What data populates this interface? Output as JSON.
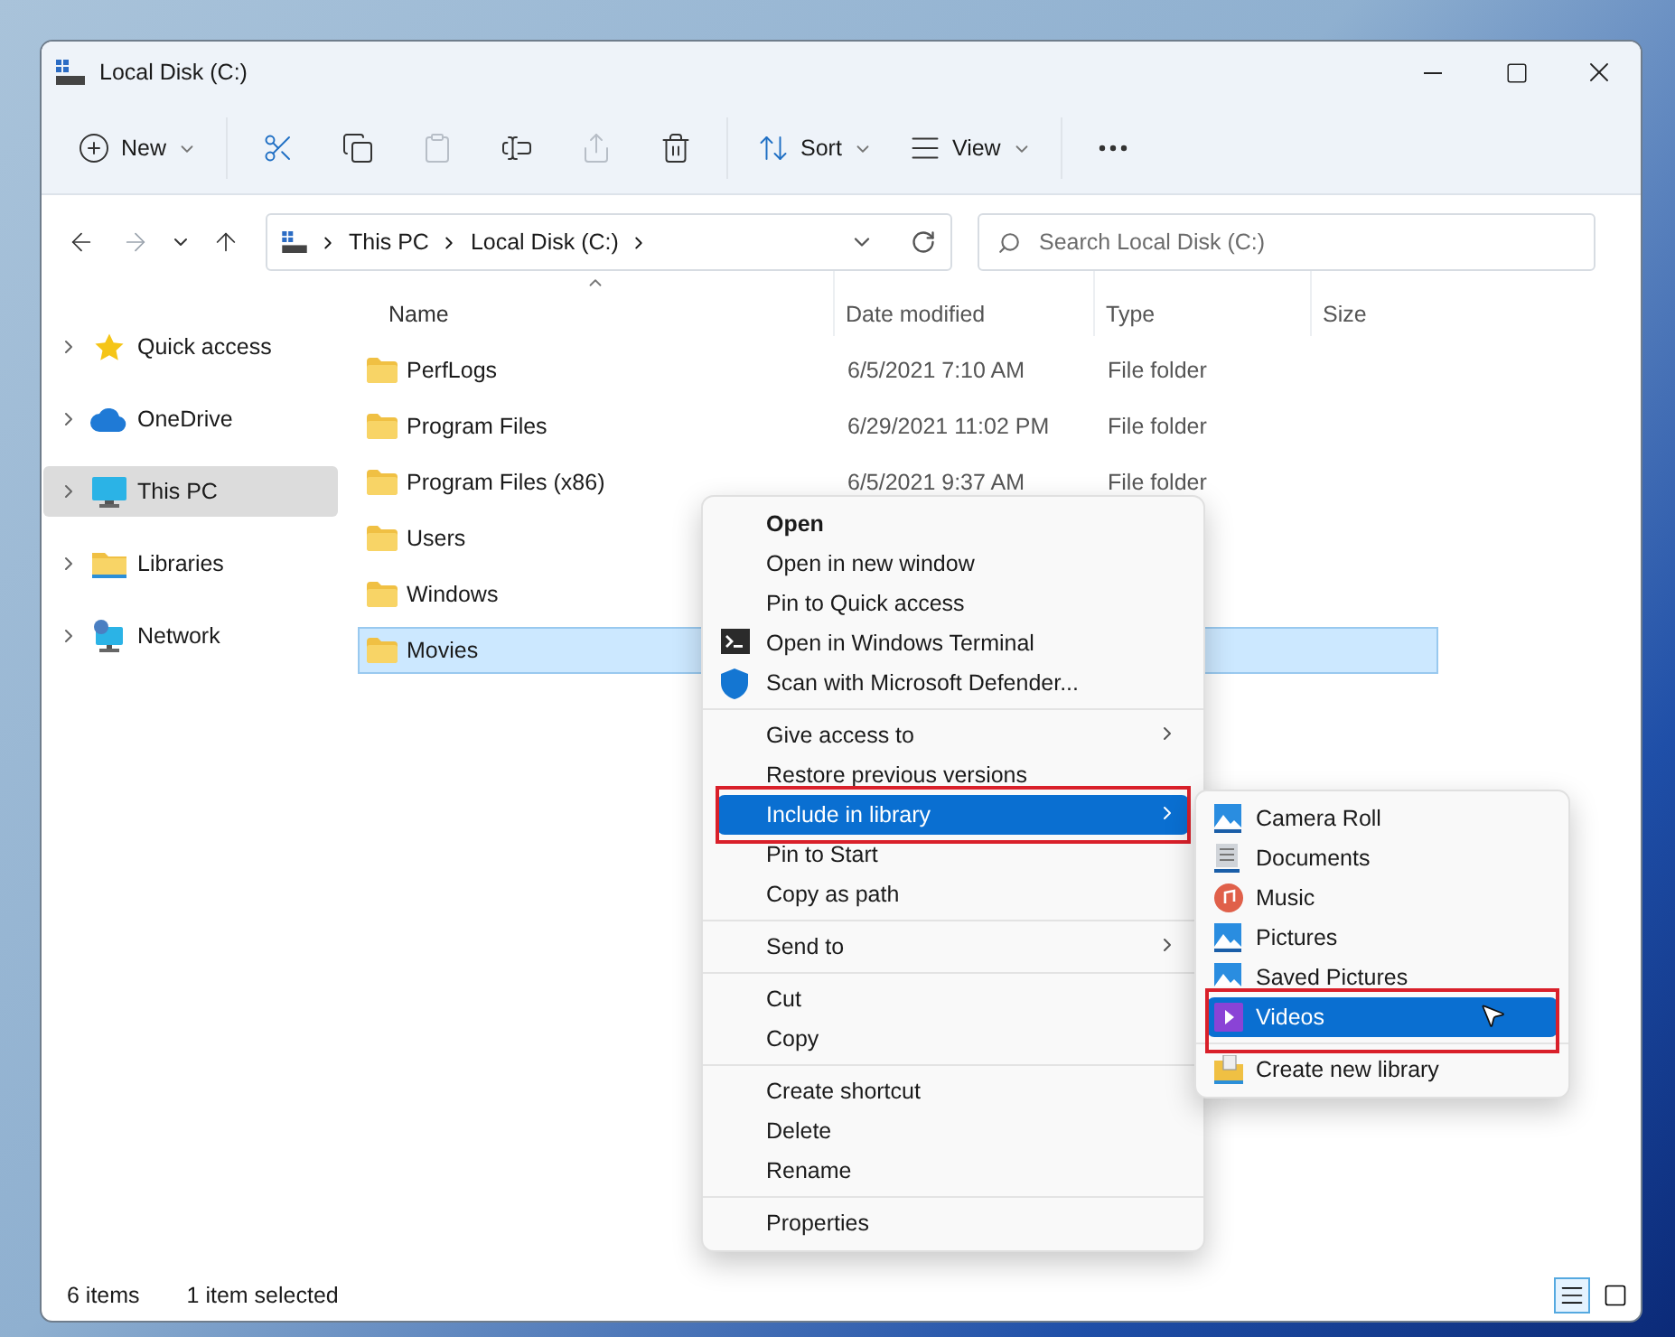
{
  "window": {
    "title": "Local Disk (C:)"
  },
  "toolbar": [
    {
      "label": "New",
      "disabled": false,
      "dropdown": true
    },
    {
      "disabled": false,
      "dropdown": false
    },
    {
      "disabled": false,
      "dropdown": false
    },
    {
      "disabled": true,
      "dropdown": false
    },
    {
      "disabled": false,
      "dropdown": false
    },
    {
      "disabled": true,
      "dropdown": false
    },
    {
      "disabled": false,
      "dropdown": false
    },
    {
      "label": "Sort",
      "disabled": false,
      "dropdown": true
    },
    {
      "label": "View",
      "disabled": false,
      "dropdown": true
    },
    {
      "disabled": false,
      "dropdown": false
    }
  ],
  "address": {
    "path": [
      "This PC",
      "Local Disk (C:)"
    ]
  },
  "search": {
    "placeholder": "Search Local Disk (C:)"
  },
  "sidebar": {
    "items": [
      {
        "label": "Quick access",
        "selected": false,
        "expanded": false
      },
      {
        "label": "OneDrive",
        "selected": false,
        "expanded": false
      },
      {
        "label": "This PC",
        "selected": true,
        "expanded": false
      },
      {
        "label": "Libraries",
        "selected": false,
        "expanded": false
      },
      {
        "label": "Network",
        "selected": false,
        "expanded": false
      }
    ]
  },
  "table": {
    "columns": [
      {
        "label": "Name",
        "sorted": true
      },
      {
        "label": "Date modified",
        "sorted": false
      },
      {
        "label": "Type",
        "sorted": false
      },
      {
        "label": "Size",
        "sorted": false
      }
    ],
    "rows": [
      {
        "name": "PerfLogs",
        "date": "6/5/2021 7:10 AM",
        "type": "File folder",
        "selected": false
      },
      {
        "name": "Program Files",
        "date": "6/29/2021 11:02 PM",
        "type": "File folder",
        "selected": false
      },
      {
        "name": "Program Files (x86)",
        "date": "6/5/2021 9:37 AM",
        "type": "File folder",
        "selected": false
      },
      {
        "name": "Users",
        "selected": false
      },
      {
        "name": "Windows",
        "selected": false
      },
      {
        "name": "Movies",
        "selected": true
      }
    ]
  },
  "status_bar": {
    "count": "6 items",
    "selection": "1 item selected",
    "views": [
      {
        "selected": true
      },
      {
        "selected": false
      }
    ]
  },
  "context_menu": {
    "groups": [
      [
        {
          "label": "Open",
          "bold": true,
          "submenu": false,
          "selected": false,
          "annotated": false
        },
        {
          "label": "Open in new window",
          "bold": false,
          "submenu": false,
          "selected": false,
          "annotated": false
        },
        {
          "label": "Pin to Quick access",
          "bold": false,
          "submenu": false,
          "selected": false,
          "annotated": false
        },
        {
          "label": "Open in Windows Terminal",
          "bold": false,
          "submenu": false,
          "selected": false,
          "annotated": false
        },
        {
          "label": "Scan with Microsoft Defender...",
          "bold": false,
          "submenu": false,
          "selected": false,
          "annotated": false
        }
      ],
      [
        {
          "label": "Give access to",
          "bold": false,
          "submenu": true,
          "selected": false,
          "annotated": false
        },
        {
          "label": "Restore previous versions",
          "bold": false,
          "submenu": false,
          "selected": false,
          "annotated": false
        },
        {
          "label": "Include in library",
          "bold": false,
          "submenu": true,
          "selected": true,
          "annotated": true
        },
        {
          "label": "Pin to Start",
          "bold": false,
          "submenu": false,
          "selected": false,
          "annotated": false
        },
        {
          "label": "Copy as path",
          "bold": false,
          "submenu": false,
          "selected": false,
          "annotated": false
        }
      ],
      [
        {
          "label": "Send to",
          "bold": false,
          "submenu": true,
          "selected": false,
          "annotated": false
        }
      ],
      [
        {
          "label": "Cut",
          "bold": false,
          "submenu": false,
          "selected": false,
          "annotated": false
        },
        {
          "label": "Copy",
          "bold": false,
          "submenu": false,
          "selected": false,
          "annotated": false
        }
      ],
      [
        {
          "label": "Create shortcut",
          "bold": false,
          "submenu": false,
          "selected": false,
          "annotated": false
        },
        {
          "label": "Delete",
          "bold": false,
          "submenu": false,
          "selected": false,
          "annotated": false
        },
        {
          "label": "Rename",
          "bold": false,
          "submenu": false,
          "selected": false,
          "annotated": false
        }
      ],
      [
        {
          "label": "Properties",
          "bold": false,
          "submenu": false,
          "selected": false,
          "annotated": false
        }
      ]
    ]
  },
  "library_menu": {
    "groups": [
      [
        {
          "label": "Camera Roll",
          "selected": false,
          "annotated": false
        },
        {
          "label": "Documents",
          "selected": false,
          "annotated": false
        },
        {
          "label": "Music",
          "selected": false,
          "annotated": false
        },
        {
          "label": "Pictures",
          "selected": false,
          "annotated": false
        },
        {
          "label": "Saved Pictures",
          "selected": false,
          "annotated": false
        },
        {
          "label": "Videos",
          "selected": true,
          "annotated": true
        }
      ],
      [
        {
          "label": "Create new library",
          "selected": false,
          "annotated": false
        }
      ]
    ]
  }
}
